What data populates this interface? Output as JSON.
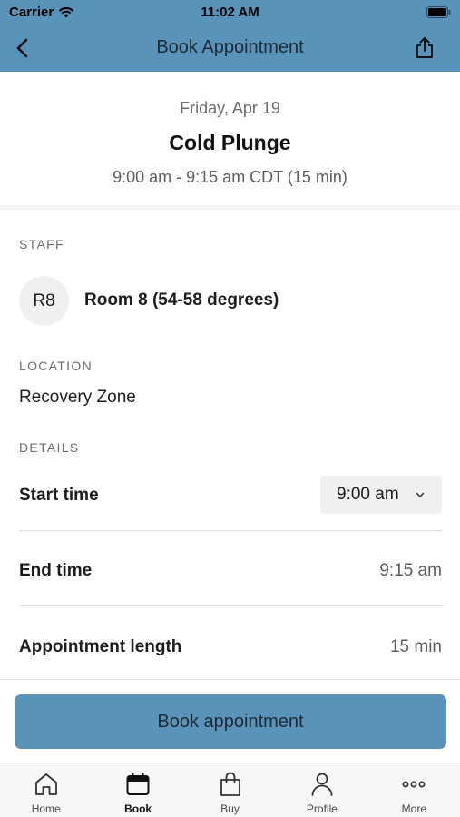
{
  "status_bar": {
    "carrier": "Carrier",
    "time": "11:02 AM"
  },
  "nav": {
    "title": "Book Appointment"
  },
  "header": {
    "date": "Friday, Apr 19",
    "service": "Cold Plunge",
    "time_range": "9:00 am - 9:15 am CDT (15 min)"
  },
  "staff": {
    "section_label": "STAFF",
    "initials": "R8",
    "name": "Room 8 (54-58 degrees)"
  },
  "location": {
    "section_label": "LOCATION",
    "value": "Recovery Zone"
  },
  "details": {
    "section_label": "DETAILS",
    "start_time_label": "Start time",
    "start_time_value": "9:00 am",
    "end_time_label": "End time",
    "end_time_value": "9:15 am",
    "length_label": "Appointment length",
    "length_value": "15 min"
  },
  "book_button": {
    "label": "Book appointment"
  },
  "tabs": [
    {
      "label": "Home",
      "icon": "home-icon"
    },
    {
      "label": "Book",
      "icon": "calendar-icon",
      "active": true
    },
    {
      "label": "Buy",
      "icon": "shopping-bag-icon"
    },
    {
      "label": "Profile",
      "icon": "person-icon"
    },
    {
      "label": "More",
      "icon": "more-dots-icon"
    }
  ],
  "colors": {
    "accent": "#5a93b9",
    "text": "#1c1c1e",
    "muted": "#6b6b70"
  }
}
